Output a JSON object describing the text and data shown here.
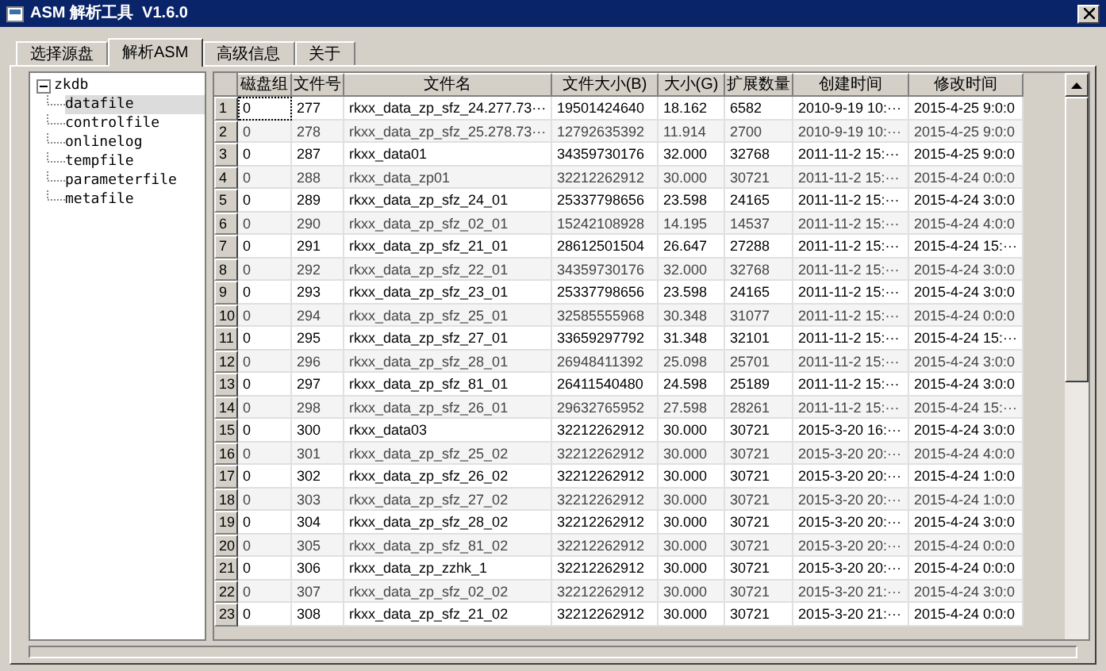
{
  "window": {
    "title": "ASM 解析工具  V1.6.0"
  },
  "tabs": [
    {
      "label": "选择源盘",
      "selected": false
    },
    {
      "label": "解析ASM",
      "selected": true
    },
    {
      "label": "高级信息",
      "selected": false
    },
    {
      "label": "关于",
      "selected": false
    }
  ],
  "tree": {
    "label": "zkdb",
    "expanded": true,
    "children": [
      {
        "label": "datafile",
        "selected": true
      },
      {
        "label": "controlfile",
        "selected": false
      },
      {
        "label": "onlinelog",
        "selected": false
      },
      {
        "label": "tempfile",
        "selected": false
      },
      {
        "label": "parameterfile",
        "selected": false
      },
      {
        "label": "metafile",
        "selected": false
      }
    ]
  },
  "table": {
    "columns": [
      "磁盘组",
      "文件号",
      "文件名",
      "文件大小(B)",
      "大小(G)",
      "扩展数量",
      "创建时间",
      "修改时间"
    ],
    "rows": [
      {
        "number": "1",
        "cells": [
          "0",
          "277",
          "rkxx_data_zp_sfz_24.277.73···",
          "19501424640",
          "18.162",
          "6582",
          "2010-9-19 10:···",
          "2015-4-25 9:0:0"
        ]
      },
      {
        "number": "2",
        "cells": [
          "0",
          "278",
          "rkxx_data_zp_sfz_25.278.73···",
          "12792635392",
          "11.914",
          "2700",
          "2010-9-19 10:···",
          "2015-4-25 9:0:0"
        ]
      },
      {
        "number": "3",
        "cells": [
          "0",
          "287",
          "rkxx_data01",
          "34359730176",
          "32.000",
          "32768",
          "2011-11-2 15:···",
          "2015-4-25 9:0:0"
        ]
      },
      {
        "number": "4",
        "cells": [
          "0",
          "288",
          "rkxx_data_zp01",
          "32212262912",
          "30.000",
          "30721",
          "2011-11-2 15:···",
          "2015-4-24 0:0:0"
        ]
      },
      {
        "number": "5",
        "cells": [
          "0",
          "289",
          "rkxx_data_zp_sfz_24_01",
          "25337798656",
          "23.598",
          "24165",
          "2011-11-2 15:···",
          "2015-4-24 3:0:0"
        ]
      },
      {
        "number": "6",
        "cells": [
          "0",
          "290",
          "rkxx_data_zp_sfz_02_01",
          "15242108928",
          "14.195",
          "14537",
          "2011-11-2 15:···",
          "2015-4-24 4:0:0"
        ]
      },
      {
        "number": "7",
        "cells": [
          "0",
          "291",
          "rkxx_data_zp_sfz_21_01",
          "28612501504",
          "26.647",
          "27288",
          "2011-11-2 15:···",
          "2015-4-24 15:···"
        ]
      },
      {
        "number": "8",
        "cells": [
          "0",
          "292",
          "rkxx_data_zp_sfz_22_01",
          "34359730176",
          "32.000",
          "32768",
          "2011-11-2 15:···",
          "2015-4-24 3:0:0"
        ]
      },
      {
        "number": "9",
        "cells": [
          "0",
          "293",
          "rkxx_data_zp_sfz_23_01",
          "25337798656",
          "23.598",
          "24165",
          "2011-11-2 15:···",
          "2015-4-24 3:0:0"
        ]
      },
      {
        "number": "10",
        "cells": [
          "0",
          "294",
          "rkxx_data_zp_sfz_25_01",
          "32585555968",
          "30.348",
          "31077",
          "2011-11-2 15:···",
          "2015-4-24 0:0:0"
        ]
      },
      {
        "number": "11",
        "cells": [
          "0",
          "295",
          "rkxx_data_zp_sfz_27_01",
          "33659297792",
          "31.348",
          "32101",
          "2011-11-2 15:···",
          "2015-4-24 15:···"
        ]
      },
      {
        "number": "12",
        "cells": [
          "0",
          "296",
          "rkxx_data_zp_sfz_28_01",
          "26948411392",
          "25.098",
          "25701",
          "2011-11-2 15:···",
          "2015-4-24 3:0:0"
        ]
      },
      {
        "number": "13",
        "cells": [
          "0",
          "297",
          "rkxx_data_zp_sfz_81_01",
          "26411540480",
          "24.598",
          "25189",
          "2011-11-2 15:···",
          "2015-4-24 3:0:0"
        ]
      },
      {
        "number": "14",
        "cells": [
          "0",
          "298",
          "rkxx_data_zp_sfz_26_01",
          "29632765952",
          "27.598",
          "28261",
          "2011-11-2 15:···",
          "2015-4-24 15:···"
        ]
      },
      {
        "number": "15",
        "cells": [
          "0",
          "300",
          "rkxx_data03",
          "32212262912",
          "30.000",
          "30721",
          "2015-3-20 16:···",
          "2015-4-24 3:0:0"
        ]
      },
      {
        "number": "16",
        "cells": [
          "0",
          "301",
          "rkxx_data_zp_sfz_25_02",
          "32212262912",
          "30.000",
          "30721",
          "2015-3-20 20:···",
          "2015-4-24 4:0:0"
        ]
      },
      {
        "number": "17",
        "cells": [
          "0",
          "302",
          "rkxx_data_zp_sfz_26_02",
          "32212262912",
          "30.000",
          "30721",
          "2015-3-20 20:···",
          "2015-4-24 1:0:0"
        ]
      },
      {
        "number": "18",
        "cells": [
          "0",
          "303",
          "rkxx_data_zp_sfz_27_02",
          "32212262912",
          "30.000",
          "30721",
          "2015-3-20 20:···",
          "2015-4-24 1:0:0"
        ]
      },
      {
        "number": "19",
        "cells": [
          "0",
          "304",
          "rkxx_data_zp_sfz_28_02",
          "32212262912",
          "30.000",
          "30721",
          "2015-3-20 20:···",
          "2015-4-24 3:0:0"
        ]
      },
      {
        "number": "20",
        "cells": [
          "0",
          "305",
          "rkxx_data_zp_sfz_81_02",
          "32212262912",
          "30.000",
          "30721",
          "2015-3-20 20:···",
          "2015-4-24 0:0:0"
        ]
      },
      {
        "number": "21",
        "cells": [
          "0",
          "306",
          "rkxx_data_zp_zzhk_1",
          "32212262912",
          "30.000",
          "30721",
          "2015-3-20 20:···",
          "2015-4-24 0:0:0"
        ]
      },
      {
        "number": "22",
        "cells": [
          "0",
          "307",
          "rkxx_data_zp_sfz_02_02",
          "32212262912",
          "30.000",
          "30721",
          "2015-3-20 21:···",
          "2015-4-24 3:0:0"
        ]
      },
      {
        "number": "23",
        "cells": [
          "0",
          "308",
          "rkxx_data_zp_sfz_21_02",
          "32212262912",
          "30.000",
          "30721",
          "2015-3-20 21:···",
          "2015-4-24 0:0:0"
        ]
      }
    ]
  }
}
